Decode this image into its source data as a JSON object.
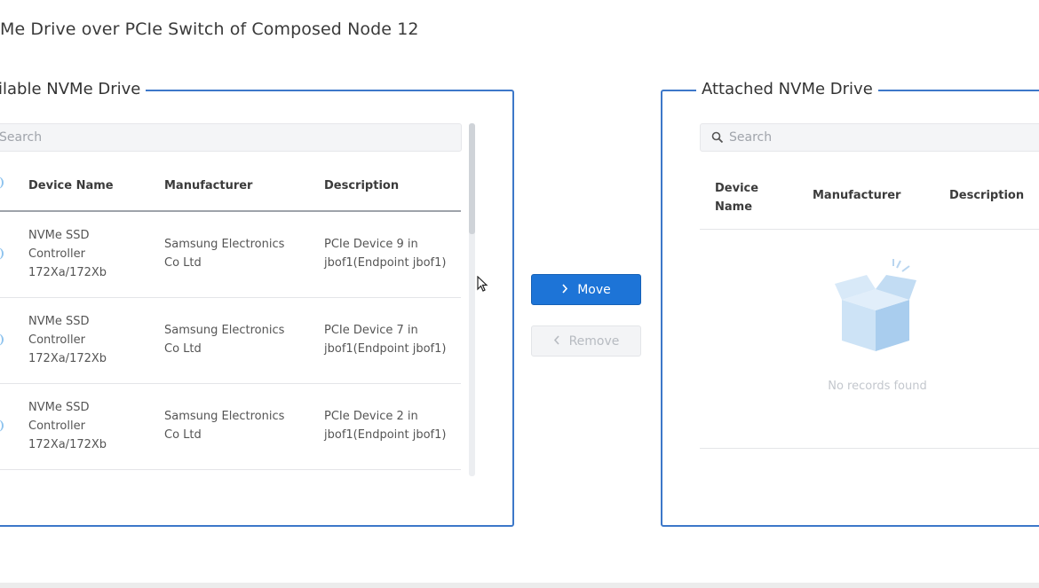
{
  "page_title": "Me Drive over PCIe Switch of Composed Node 12",
  "available": {
    "legend": "ilable NVMe Drive",
    "search_placeholder": "Search",
    "columns": [
      "Device Name",
      "Manufacturer",
      "Description"
    ],
    "rows": [
      {
        "device_name": [
          "NVMe SSD",
          "Controller",
          "172Xa/172Xb"
        ],
        "manufacturer": [
          "Samsung Electronics",
          "Co Ltd"
        ],
        "description": [
          "PCIe Device 9 in",
          "jbof1(Endpoint jbof1)"
        ]
      },
      {
        "device_name": [
          "NVMe SSD",
          "Controller",
          "172Xa/172Xb"
        ],
        "manufacturer": [
          "Samsung Electronics",
          "Co Ltd"
        ],
        "description": [
          "PCIe Device 7 in",
          "jbof1(Endpoint jbof1)"
        ]
      },
      {
        "device_name": [
          "NVMe SSD",
          "Controller",
          "172Xa/172Xb"
        ],
        "manufacturer": [
          "Samsung Electronics",
          "Co Ltd"
        ],
        "description": [
          "PCIe Device 2 in",
          "jbof1(Endpoint jbof1)"
        ]
      }
    ]
  },
  "actions": {
    "move_label": "Move",
    "remove_label": "Remove",
    "move_icon": "chevron-right-icon",
    "remove_icon": "chevron-left-icon"
  },
  "attached": {
    "legend": "Attached NVMe Drive",
    "search_placeholder": "Search",
    "columns": [
      "Device",
      "Name",
      "Manufacturer",
      "Description"
    ],
    "empty_text": "No records found"
  },
  "colors": {
    "accent": "#1d74d7",
    "border": "#3d78c9"
  }
}
